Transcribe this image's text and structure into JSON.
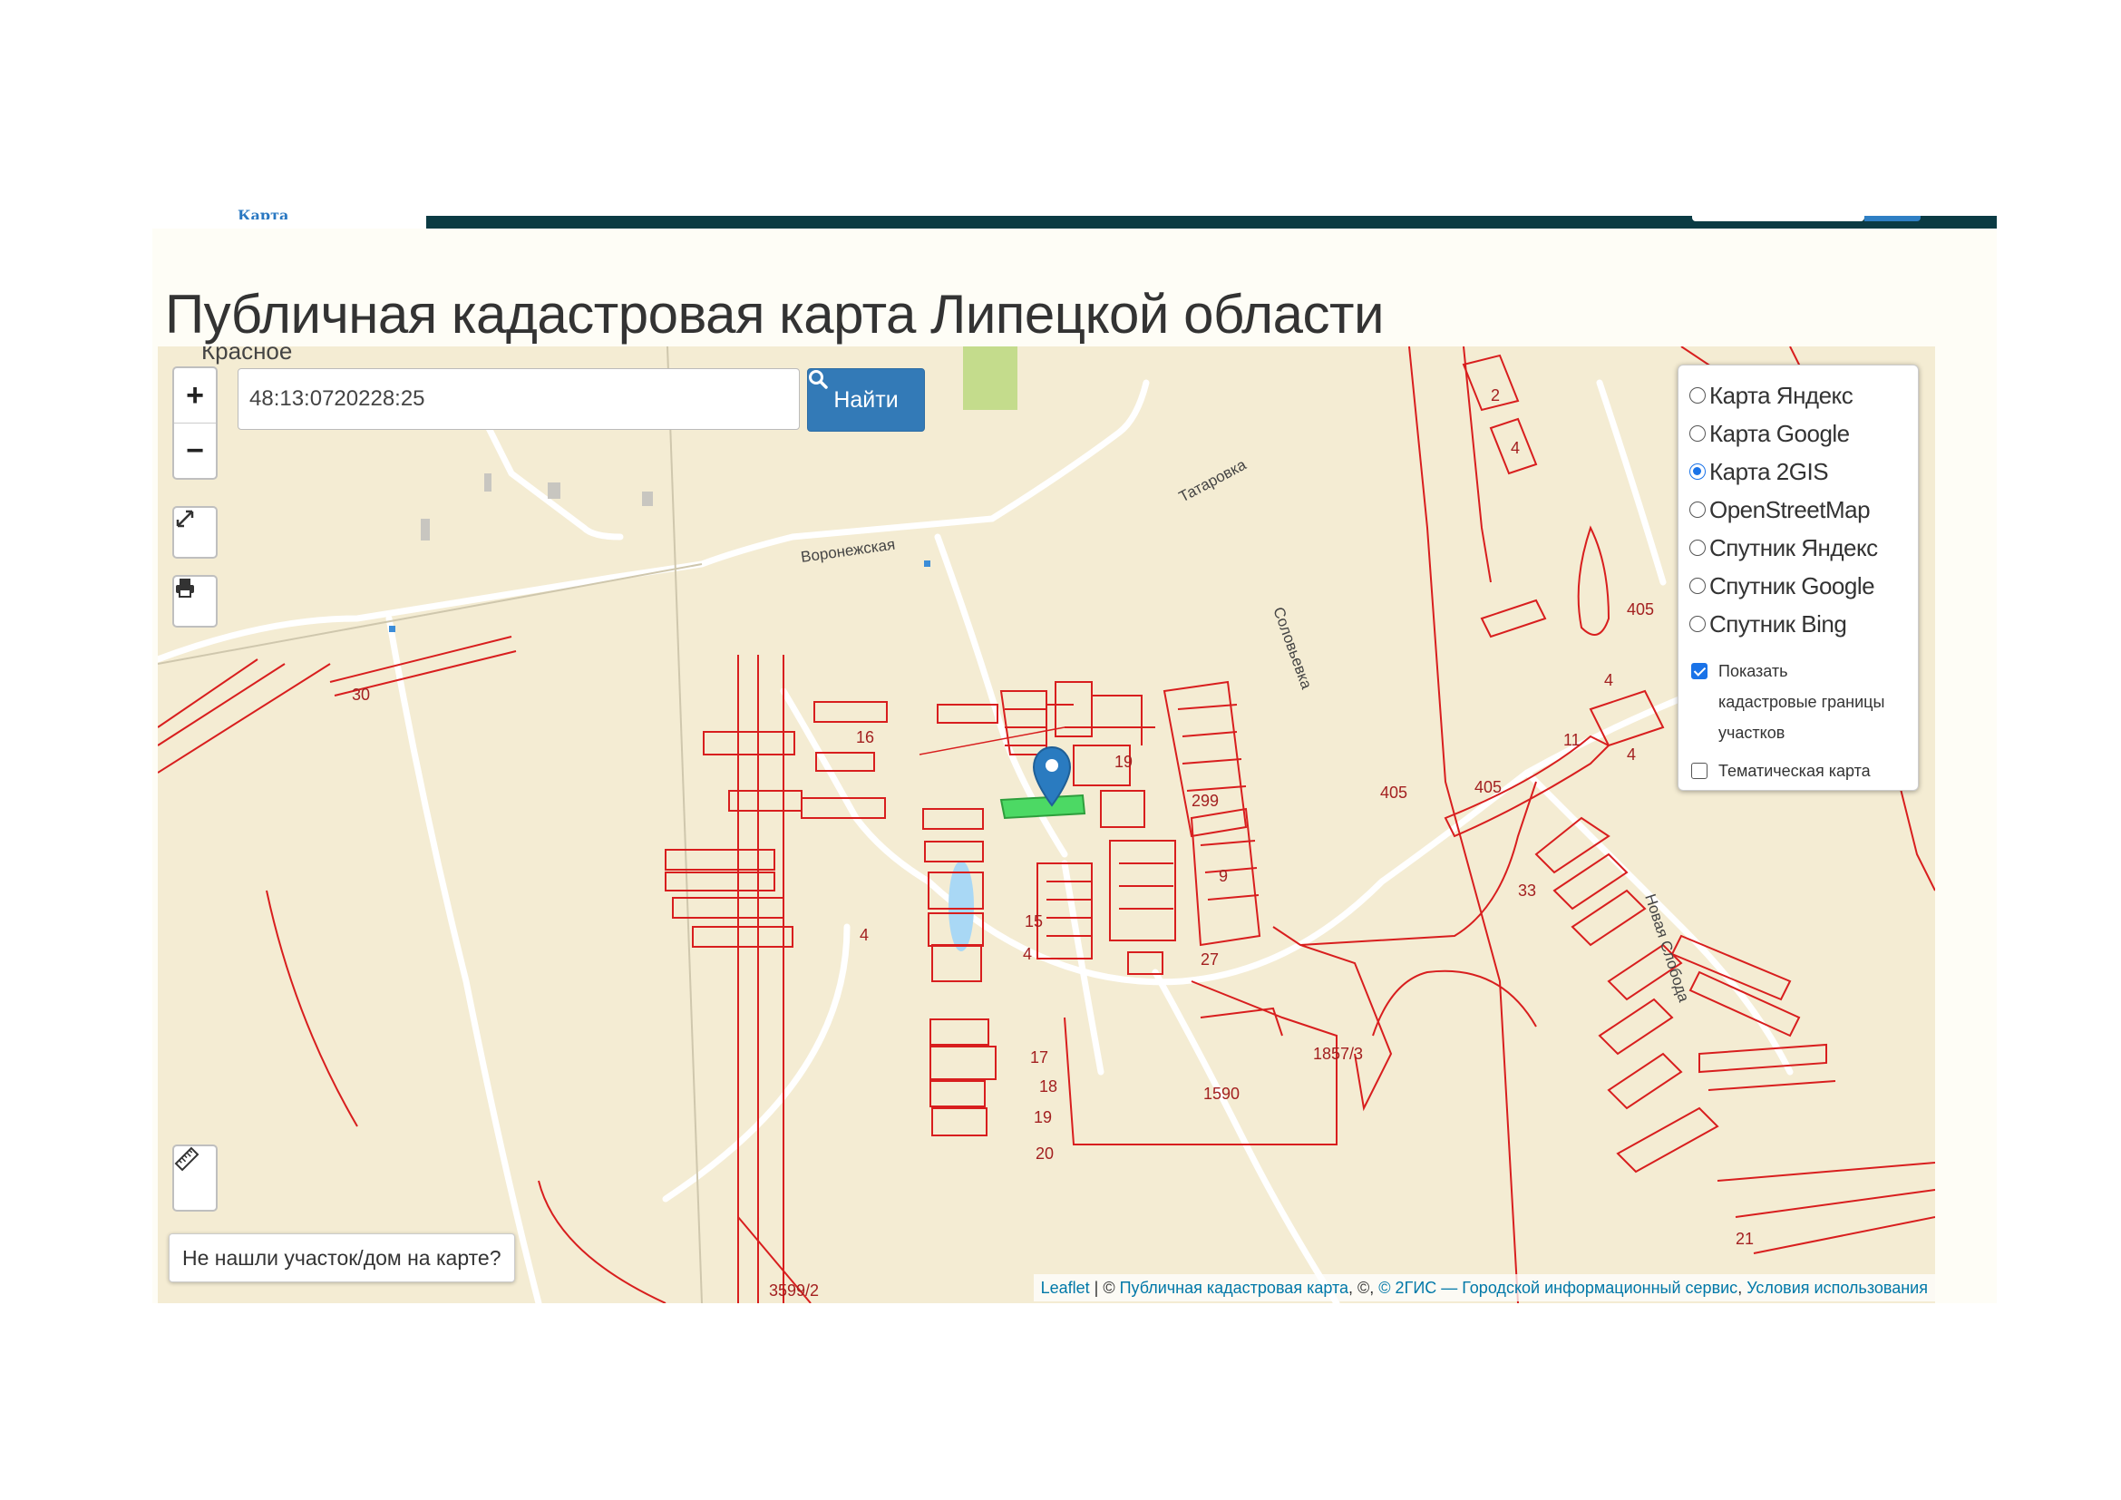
{
  "header": {
    "logo_fragment": "Карта"
  },
  "page": {
    "title": "Публичная кадастровая карта Липецкой области"
  },
  "search": {
    "value": "48:13:0720228:25",
    "button_label": "Найти"
  },
  "zoom": {
    "in": "+",
    "out": "−"
  },
  "icons": {
    "fullscreen": "fullscreen-icon",
    "print": "print-icon",
    "ruler": "ruler-icon",
    "search": "search-icon"
  },
  "layers": {
    "options": [
      "Карта Яндекс",
      "Карта Google",
      "Карта 2GIS",
      "OpenStreetMap",
      "Спутник Яндекс",
      "Спутник Google",
      "Спутник Bing"
    ],
    "selected": "Карта 2GIS",
    "show_cadastral_label": "Показать кадастровые границы участков",
    "show_cadastral_checked": true,
    "thematic_label": "Тематическая карта",
    "thematic_checked": false
  },
  "not_found_button": "Не нашли участок/дом на карте?",
  "attribution": {
    "leaflet": "Leaflet",
    "sep1": " | © ",
    "pkk": "Публичная кадастровая карта",
    "mid": ", ©, ",
    "twogis": "© 2ГИС — Городской информационный сервис",
    "sep2": ", ",
    "terms": "Условия использования"
  },
  "map": {
    "place_labels": [
      "Красное",
      "Воронежская",
      "Татаровка",
      "Соловьевка",
      "Новая Слобода"
    ],
    "parcel_numbers": [
      "30",
      "16",
      "4",
      "19",
      "299",
      "9",
      "15",
      "4",
      "27",
      "17",
      "18",
      "19",
      "20",
      "1590",
      "1857/3",
      "405",
      "405",
      "405",
      "33",
      "11",
      "4",
      "4",
      "2",
      "21",
      "3599/2"
    ]
  },
  "colors": {
    "map_bg": "#f4ecd3",
    "parcel": "#d81e1e",
    "highlight": "#4cd964",
    "marker": "#2a7bc0",
    "accent": "#337ab7",
    "header_bar": "#0b3b44"
  }
}
